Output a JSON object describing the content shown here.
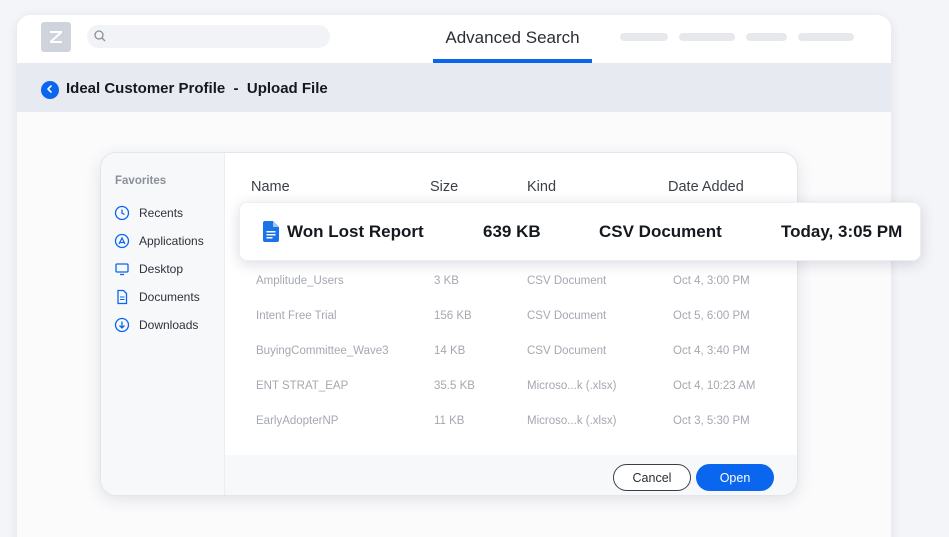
{
  "header": {
    "logo_icon": "zoominfo-z-logo",
    "search_icon": "search-icon",
    "active_tab": "Advanced Search"
  },
  "subheader": {
    "back_icon": "chevron-left-icon",
    "title": "Ideal Customer Profile  -  Upload File"
  },
  "dialog": {
    "sidebar": {
      "title": "Favorites",
      "items": [
        {
          "label": "Recents",
          "icon": "clock-icon"
        },
        {
          "label": "Applications",
          "icon": "app-store-icon"
        },
        {
          "label": "Desktop",
          "icon": "monitor-icon"
        },
        {
          "label": "Documents",
          "icon": "document-icon"
        },
        {
          "label": "Downloads",
          "icon": "download-icon"
        }
      ]
    },
    "columns": {
      "name": "Name",
      "size": "Size",
      "kind": "Kind",
      "date": "Date Added"
    },
    "selected_file": {
      "name": "Won Lost Report",
      "size": "639 KB",
      "kind": "CSV Document",
      "date": "Today, 3:05 PM",
      "icon": "google-doc-icon"
    },
    "files": [
      {
        "name": "Amplitude_Users",
        "size": "3 KB",
        "kind": "CSV Document",
        "date": "Oct 4, 3:00 PM"
      },
      {
        "name": "Intent Free Trial",
        "size": "156 KB",
        "kind": "CSV Document",
        "date": "Oct 5, 6:00 PM"
      },
      {
        "name": "BuyingCommittee_Wave3",
        "size": "14 KB",
        "kind": "CSV Document",
        "date": "Oct 4, 3:40 PM"
      },
      {
        "name": "ENT STRAT_EAP",
        "size": "35.5 KB",
        "kind": "Microso...k (.xlsx)",
        "date": "Oct 4, 10:23 AM"
      },
      {
        "name": "EarlyAdopterNP",
        "size": "11 KB",
        "kind": "Microso...k (.xlsx)",
        "date": "Oct 3, 5:30 PM"
      }
    ],
    "cancel_label": "Cancel",
    "open_label": "Open"
  },
  "colors": {
    "accent": "#0a66ee",
    "subheader_bg": "#e7eaf0",
    "muted_text": "#a4a8b0"
  }
}
